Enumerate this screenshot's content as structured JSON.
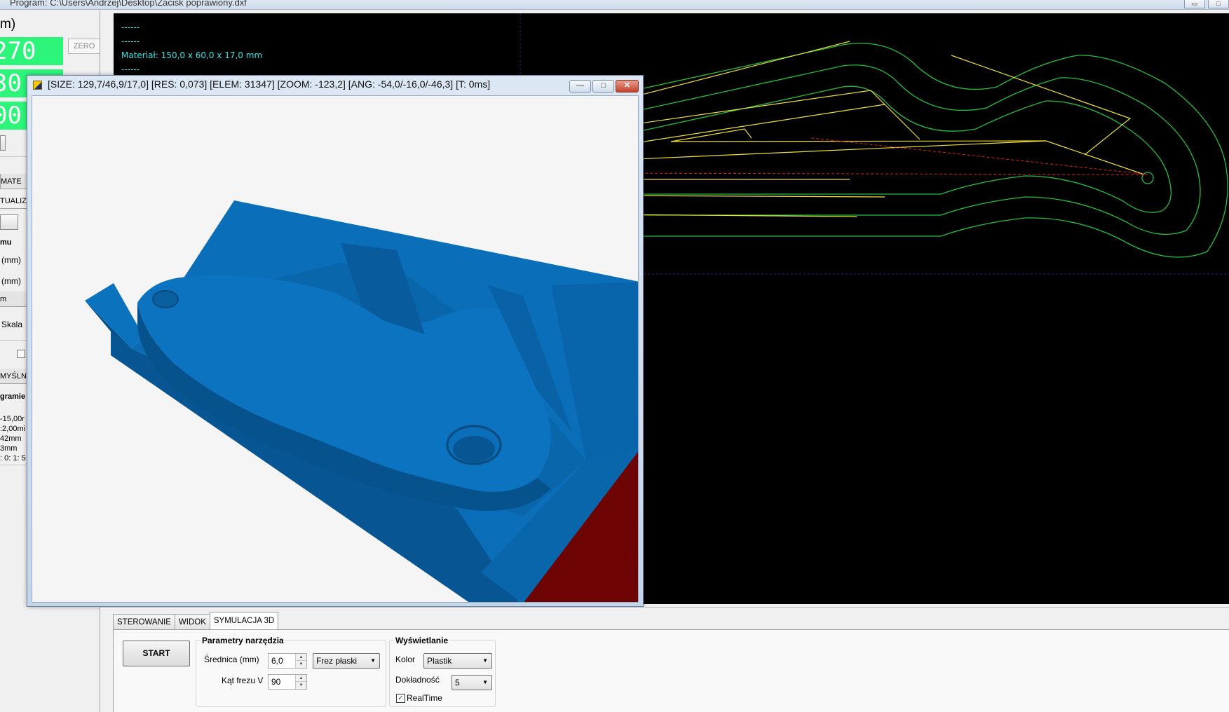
{
  "main_window": {
    "title": "Program: C:\\Users\\Andrzej\\Desktop\\Zacisk poprawiony.dxf",
    "btn_minimize": "▭",
    "btn_restore": "□"
  },
  "left_panel": {
    "unit_label": "m)",
    "coord_x": "270",
    "coord_y": "30",
    "coord_z": "00",
    "zero_label": "ZERO",
    "mater_label": "MATE",
    "aktualiz_label": "TUALIZ",
    "section_label": "mu",
    "mm_label_1": "(mm)",
    "mm_label_2": "(mm)",
    "m_label": "m",
    "skala_label": "Skala",
    "domysl_label": "MYŚLN",
    "program_label": "gramie",
    "info_lines": [
      "-15,00r",
      ":2,00mi",
      "42mm",
      "3mm",
      ": 0: 1: 5"
    ]
  },
  "cad": {
    "log_lines": [
      "------",
      "------",
      "Materiał: 150,0 x 60,0 x 17,0 mm",
      "------"
    ],
    "colors": {
      "background": "#000000",
      "toolpath": "#f0e030",
      "offset": "#22c040",
      "rapid": "#e02020",
      "grid": "#1a2a8a",
      "log": "#33e6e6"
    }
  },
  "sim_window": {
    "title": "[SIZE: 129,7/46,9/17,0] [RES: 0,073] [ELEM: 31347] [ZOOM: -123,2] [ANG: -54,0/-16,0/-46,3] [T: 0ms]",
    "btn_minimize": "—",
    "btn_maximize": "□",
    "btn_close": "✕",
    "colors": {
      "part": "#0a6fb8",
      "part_dark": "#064f88",
      "stock_cut": "#6e0303",
      "background": "#f5f5f5"
    }
  },
  "bottom": {
    "tabs": [
      {
        "label": "STEROWANIE",
        "active": false
      },
      {
        "label": "WIDOK",
        "active": false
      },
      {
        "label": "SYMULACJA 3D",
        "active": true
      }
    ],
    "start_label": "START",
    "tool_params": {
      "title": "Parametry narzędzia",
      "diameter_label": "Średnica (mm)",
      "diameter_value": "6,0",
      "tool_type": "Frez płaski",
      "v_angle_label": "Kąt frezu V",
      "v_angle_value": "90"
    },
    "display": {
      "title": "Wyświetlanie",
      "color_label": "Kolor",
      "color_value": "Plastik",
      "accuracy_label": "Dokładność",
      "accuracy_value": "5",
      "realtime_label": "RealTime",
      "realtime_checked": true,
      "check_glyph": "✓"
    }
  }
}
